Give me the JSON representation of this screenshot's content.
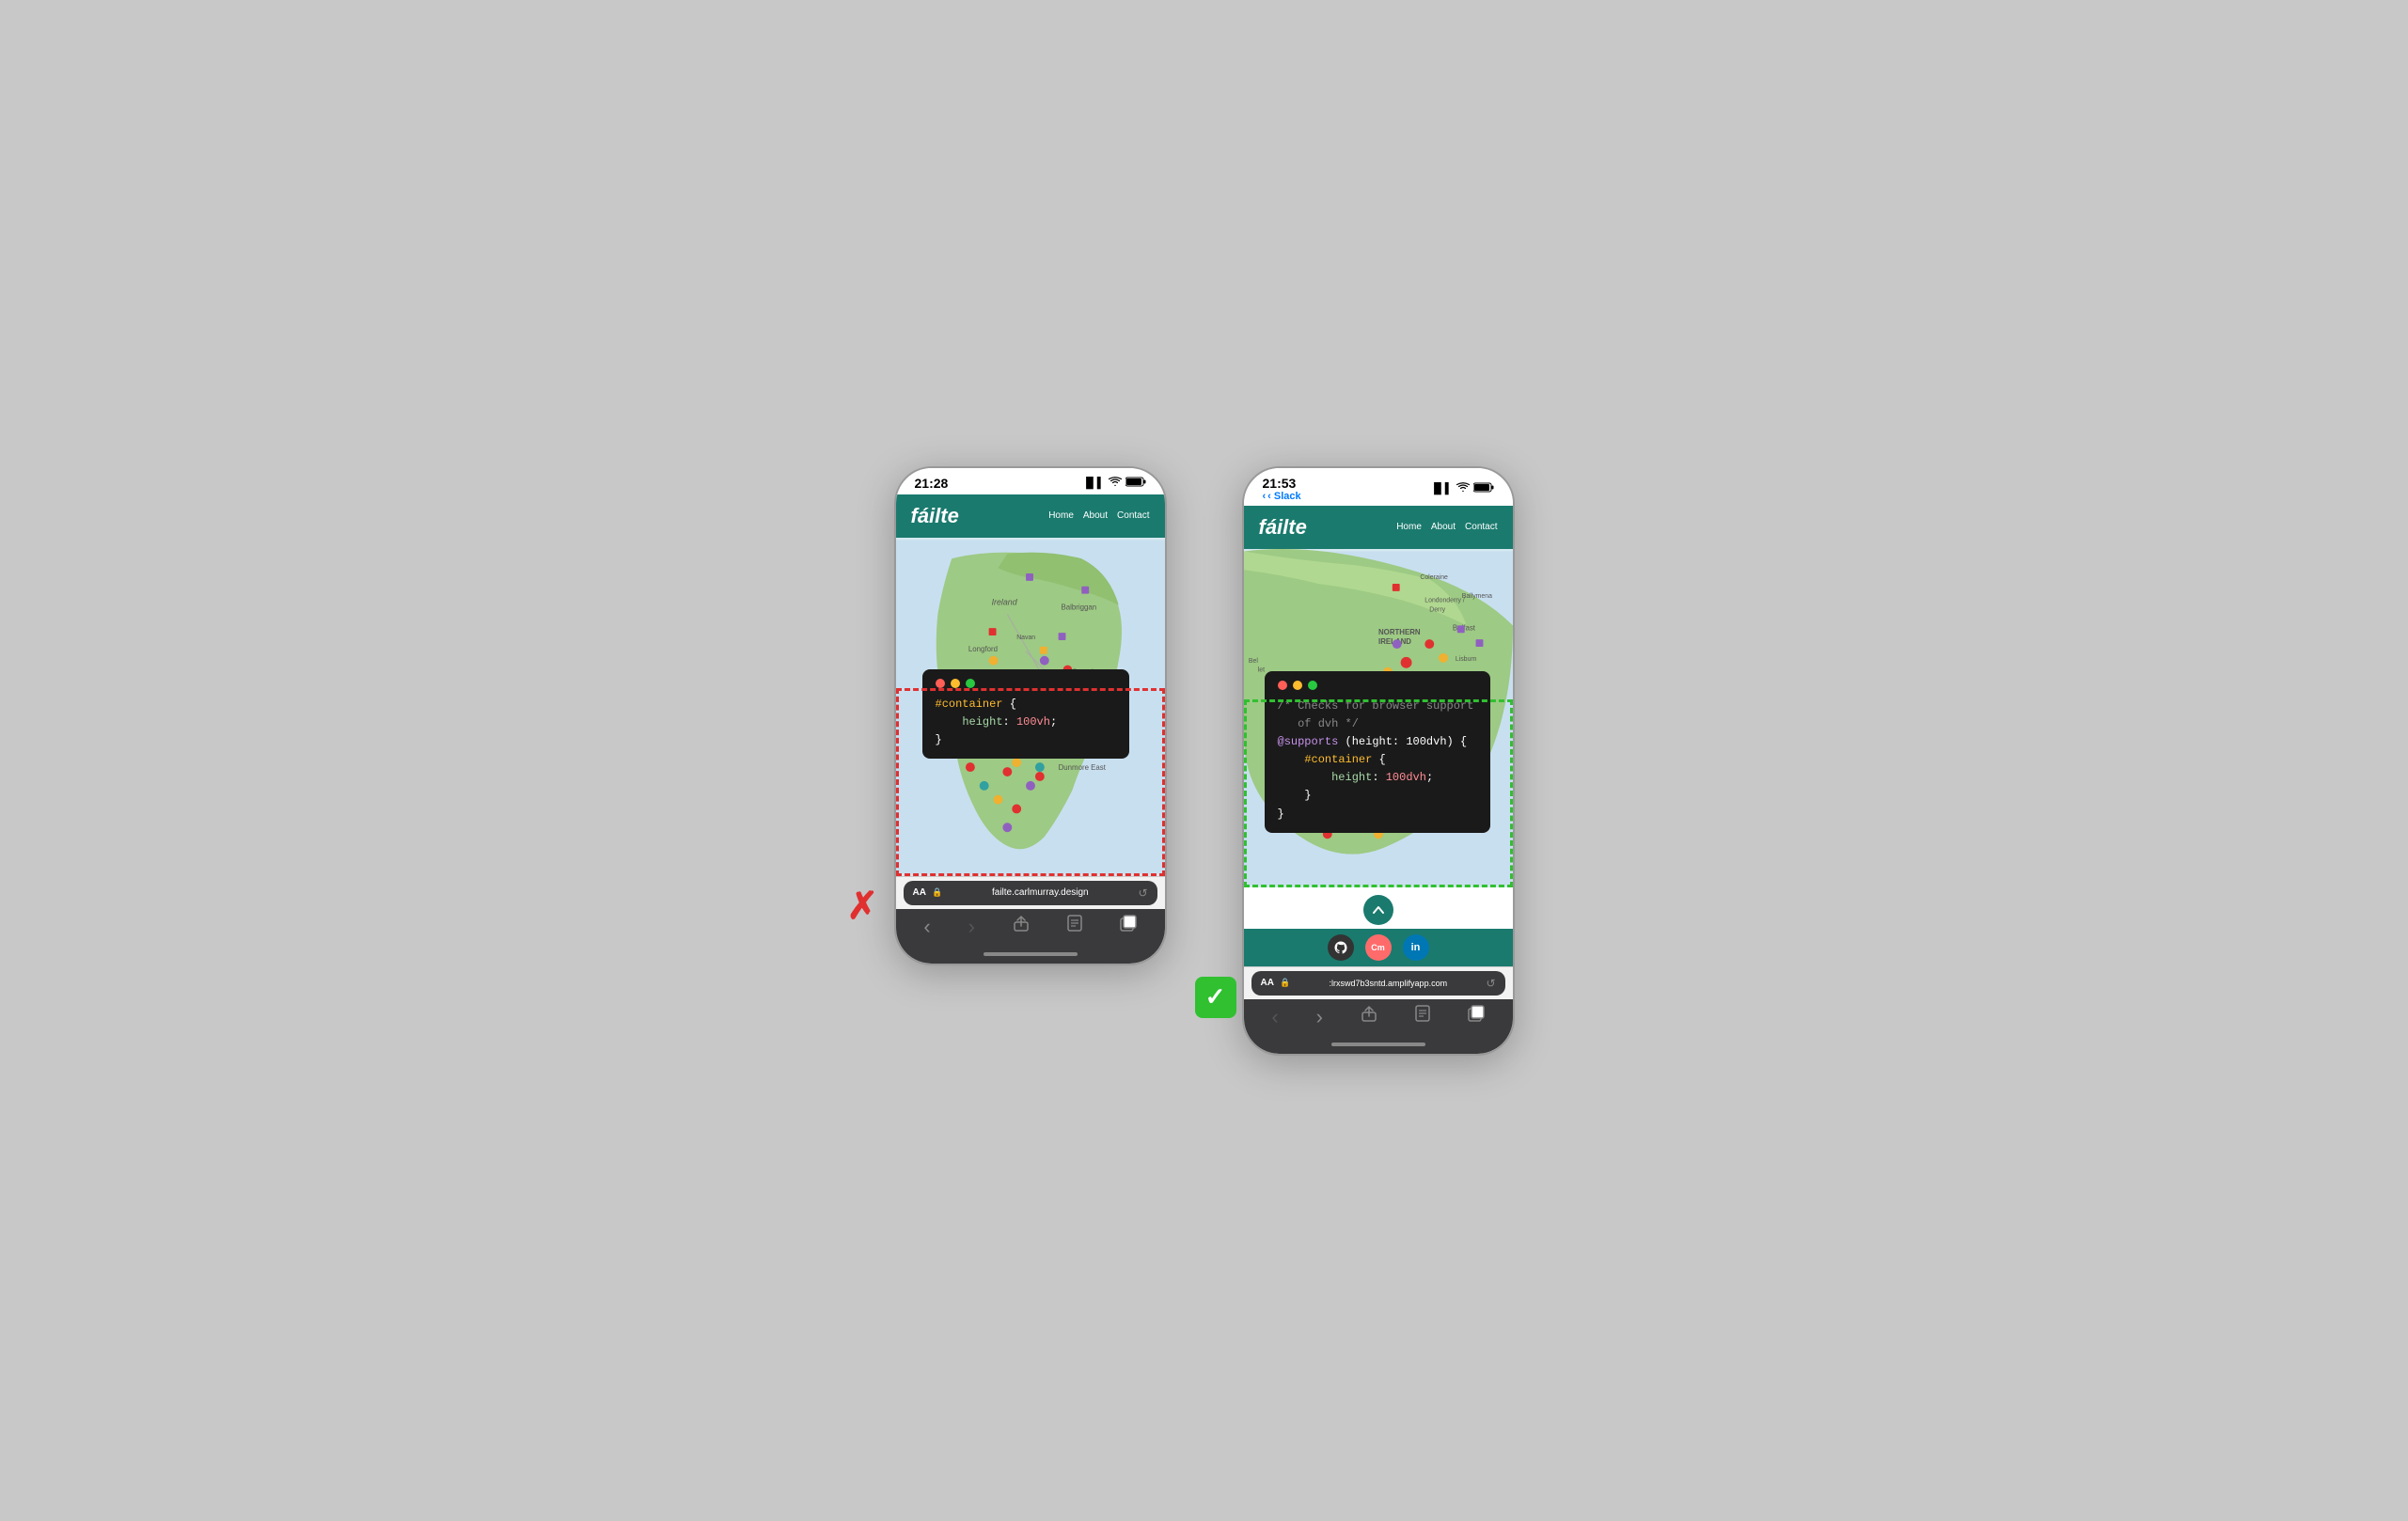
{
  "page": {
    "bg_color": "#c8c8c8"
  },
  "phone_left": {
    "status_bar": {
      "time": "21:28",
      "signal": "▐▌▌",
      "wifi": "wifi",
      "battery": "🔋"
    },
    "nav": {
      "brand": "fáilte",
      "links": [
        "Home",
        "About",
        "Contact"
      ]
    },
    "map": {
      "ireland_label": "Ireland"
    },
    "terminal": {
      "code_lines": [
        "#container {",
        "    height: 100vh;",
        "}"
      ]
    },
    "address_bar": {
      "aa": "AA",
      "url": "failte.carlmurray.design",
      "lock": "🔒"
    },
    "safari_nav": {
      "back": "‹",
      "forward": "›",
      "share": "↑",
      "bookmarks": "□",
      "tabs": "⊞"
    }
  },
  "phone_right": {
    "status_bar": {
      "time": "21:53",
      "back_label": "‹ Slack",
      "signal": "▐▌▌",
      "wifi": "wifi",
      "battery": "🔋"
    },
    "nav": {
      "brand": "fáilte",
      "links": [
        "Home",
        "About",
        "Contact"
      ]
    },
    "map": {
      "labels": [
        "Coleraine",
        "Londonderry / Derry",
        "NORTHERN IRELAND",
        "Belfast",
        "Ballymena",
        "Lisburn"
      ]
    },
    "terminal": {
      "code_lines": [
        "/* Checks for browser support",
        "   of dvh */",
        "@supports (height: 100dvh) {",
        "    #container {",
        "        height: 100dvh;",
        "    }",
        "}"
      ]
    },
    "social_icons": {
      "github": "⌥",
      "cm": "Cm",
      "linkedin": "in"
    },
    "address_bar": {
      "aa": "AA",
      "url": ":lrxswd7b3sntd.amplifyapp.com",
      "lock": "🔒"
    },
    "safari_nav": {
      "back": "‹",
      "forward": "›",
      "share": "↑",
      "bookmarks": "□",
      "tabs": "⊞"
    }
  },
  "badges": {
    "left_icon": "✗",
    "right_icon": "✓",
    "left_color": "#e03030",
    "right_color": "#30c030"
  }
}
